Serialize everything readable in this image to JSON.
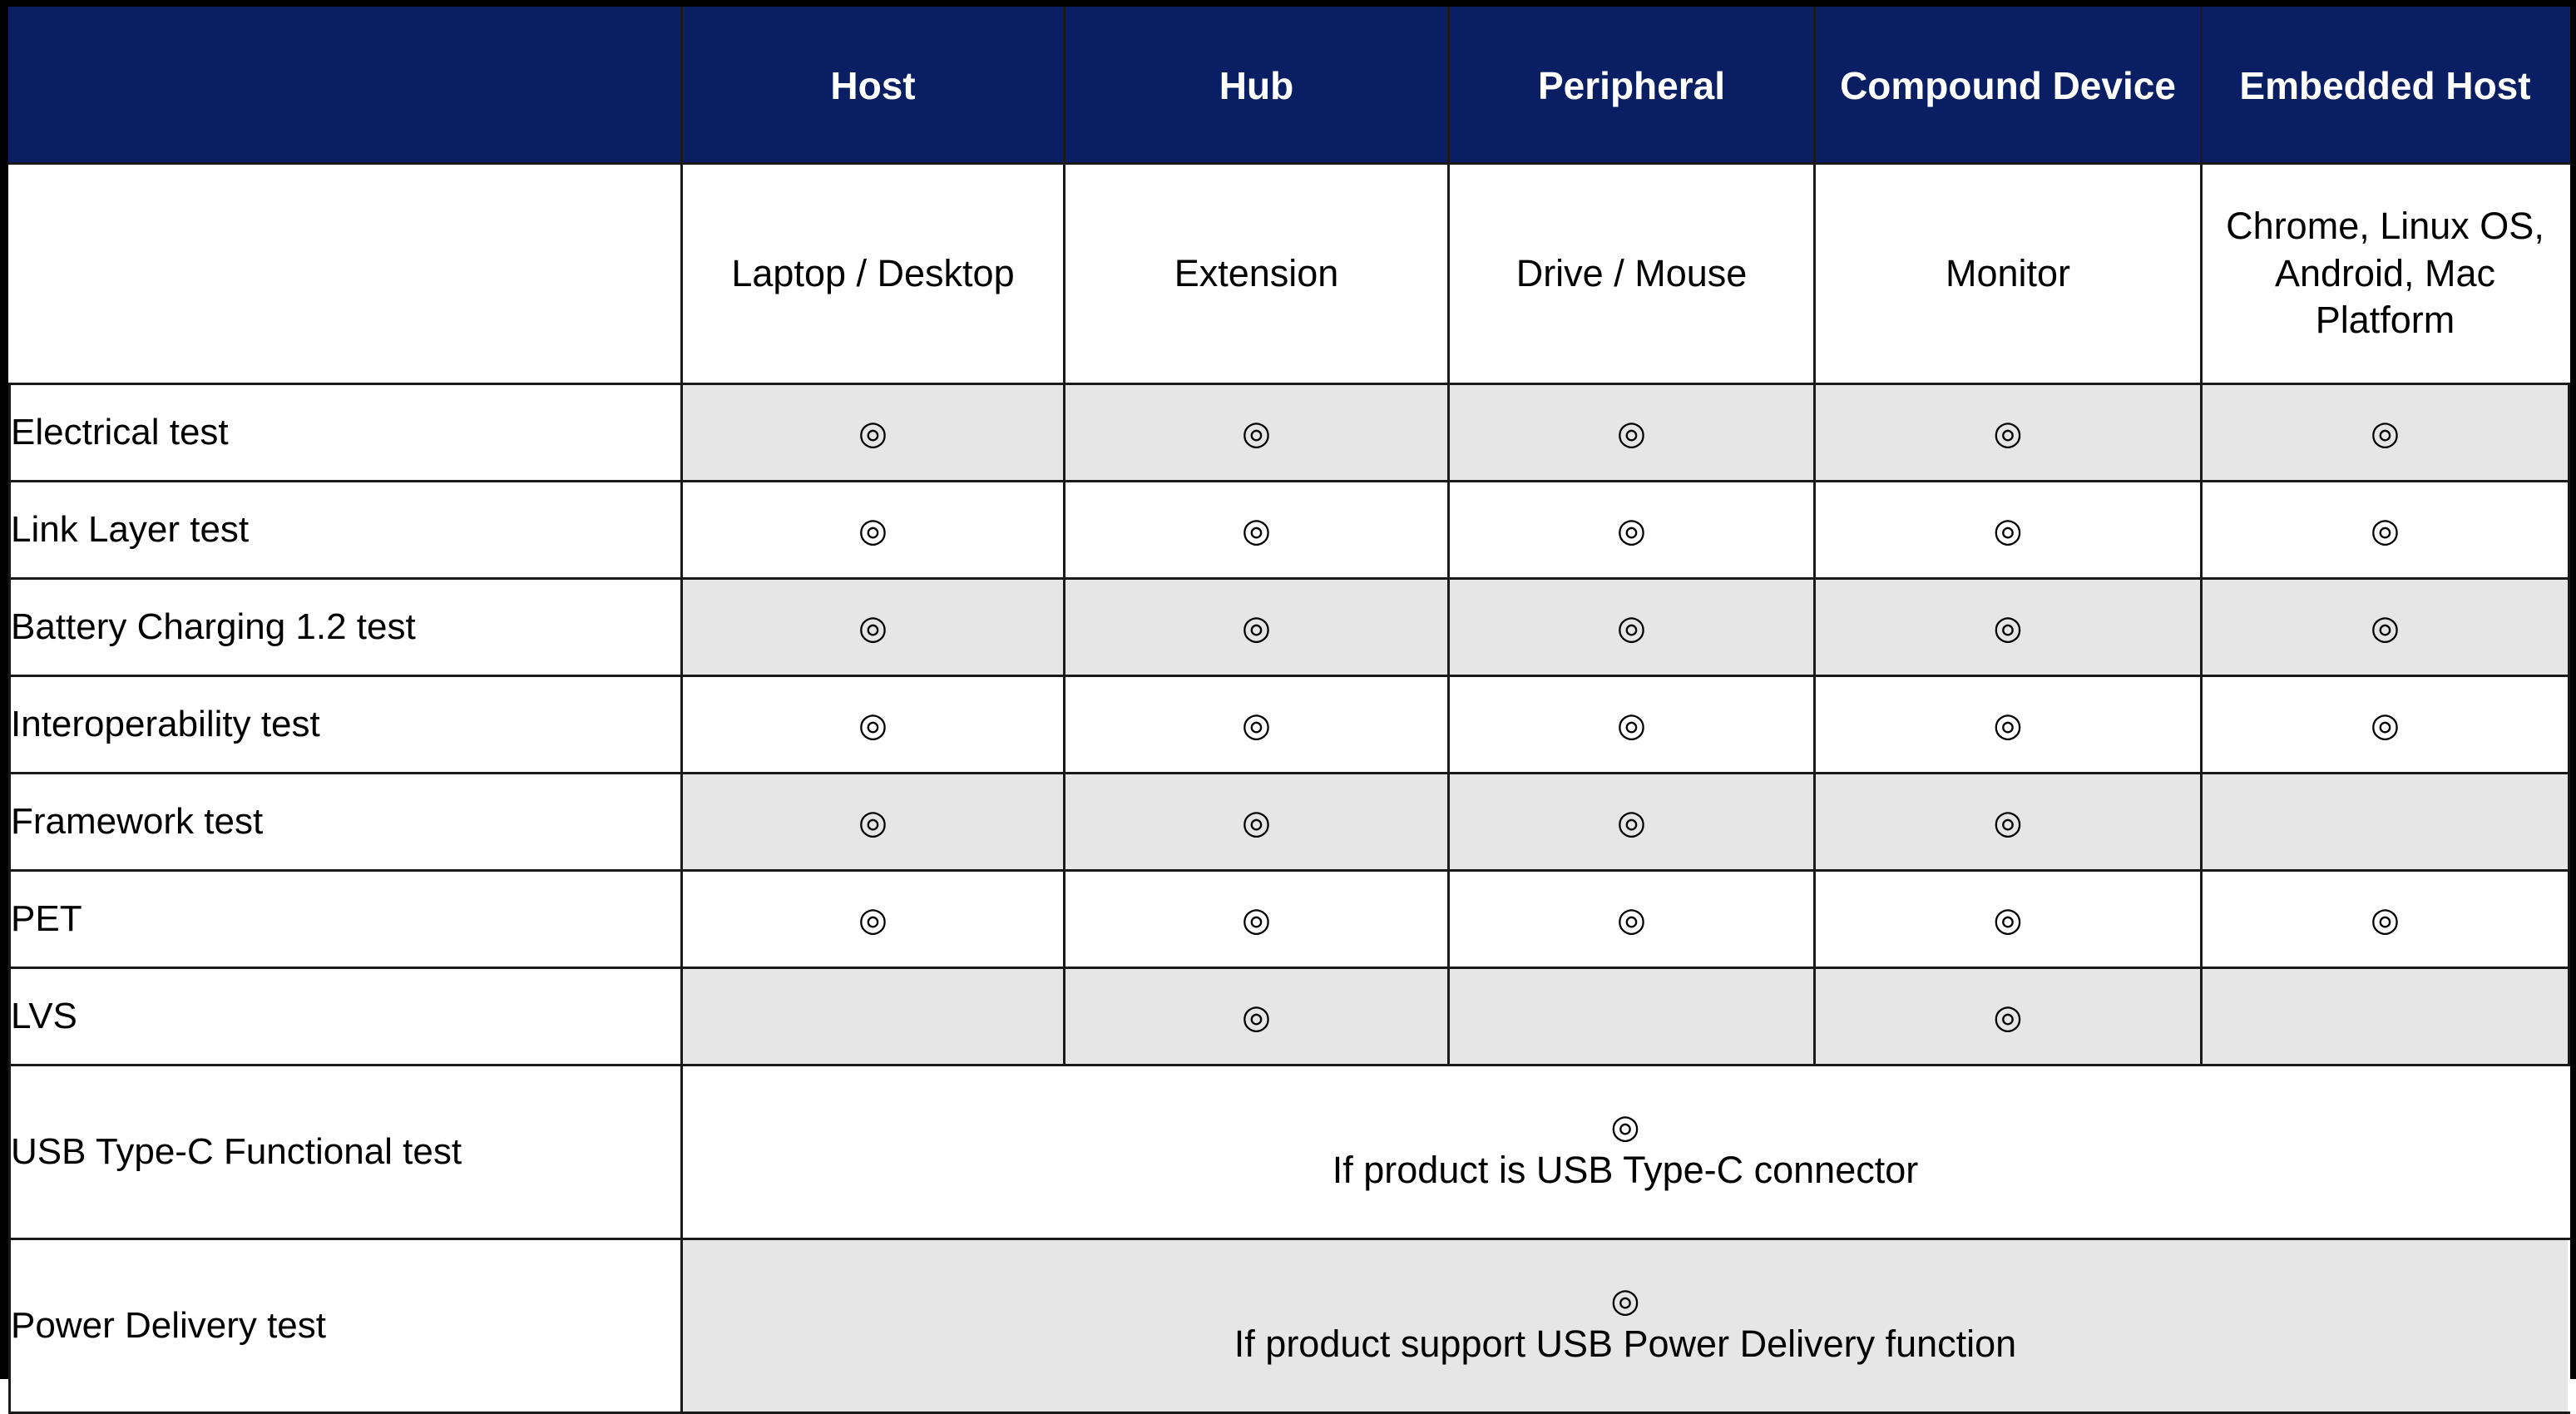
{
  "theme": {
    "header_bg": "#0a1f63",
    "header_text": "#ffffff",
    "shaded_row_bg": "#e6e6e6",
    "plain_row_bg": "#ffffff",
    "border": "#1a1a1a",
    "frame": "#000000"
  },
  "table": {
    "corner_label": "",
    "columns": [
      {
        "key": "host",
        "header": "Host",
        "description": "Laptop / Desktop"
      },
      {
        "key": "hub",
        "header": "Hub",
        "description": "Extension"
      },
      {
        "key": "peripheral",
        "header": "Peripheral",
        "description": "Drive / Mouse"
      },
      {
        "key": "compound",
        "header": "Compound Device",
        "description": "Monitor"
      },
      {
        "key": "embedded_host",
        "header": "Embedded Host",
        "description": "Chrome, Linux OS, Android, Mac Platform"
      }
    ],
    "mark_symbol": "◎",
    "rows": [
      {
        "label": "Electrical test",
        "marks": [
          true,
          true,
          true,
          true,
          true
        ],
        "shaded": true
      },
      {
        "label": "Link Layer test",
        "marks": [
          true,
          true,
          true,
          true,
          true
        ],
        "shaded": false
      },
      {
        "label": "Battery Charging 1.2 test",
        "marks": [
          true,
          true,
          true,
          true,
          true
        ],
        "shaded": true
      },
      {
        "label": "Interoperability test",
        "marks": [
          true,
          true,
          true,
          true,
          true
        ],
        "shaded": false
      },
      {
        "label": "Framework test",
        "marks": [
          true,
          true,
          true,
          true,
          false
        ],
        "shaded": true
      },
      {
        "label": "PET",
        "marks": [
          true,
          true,
          true,
          true,
          true
        ],
        "shaded": false
      },
      {
        "label": "LVS",
        "marks": [
          false,
          true,
          false,
          true,
          false
        ],
        "shaded": true
      }
    ],
    "note_rows": [
      {
        "label": "USB Type-C Functional test",
        "mark": "◎",
        "note": "If product is USB Type-C connector",
        "shaded": false
      },
      {
        "label": "Power Delivery test",
        "mark": "◎",
        "note": "If product support USB Power Delivery function",
        "shaded": true
      }
    ]
  }
}
